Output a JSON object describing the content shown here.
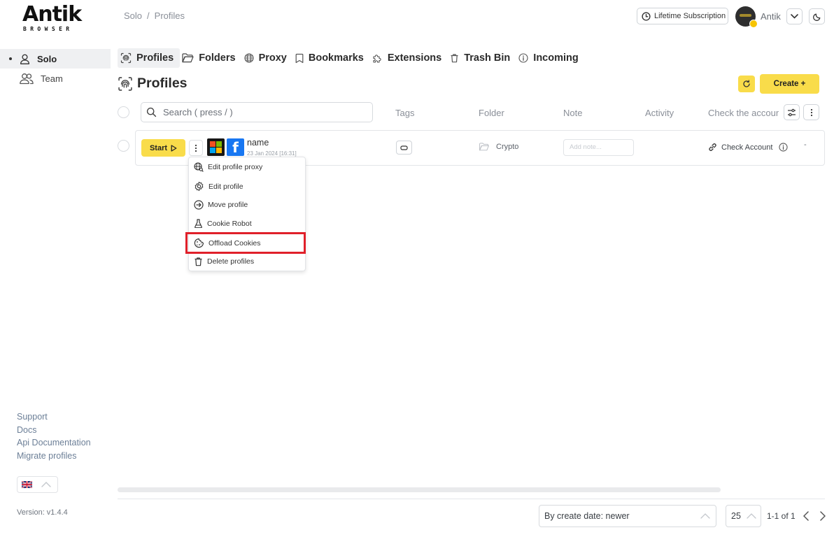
{
  "logo": {
    "word": "Antik",
    "sub": "BROWSER"
  },
  "breadcrumb": {
    "root": "Solo",
    "separator": "/",
    "current": "Profiles"
  },
  "header": {
    "subscription_label": "Lifetime Subscription",
    "username": "Antik"
  },
  "sidebar": {
    "items": [
      {
        "label": "Solo",
        "icon": "user-icon",
        "active": true
      },
      {
        "label": "Team",
        "icon": "users-icon",
        "active": false
      }
    ],
    "links": [
      "Support",
      "Docs",
      "Api Documentation",
      "Migrate profiles"
    ],
    "language": "en-gb",
    "version": "Version: v1.4.4"
  },
  "tabs": [
    {
      "label": "Profiles",
      "icon": "fingerprint-icon",
      "active": true
    },
    {
      "label": "Folders",
      "icon": "folder-icon"
    },
    {
      "label": "Proxy",
      "icon": "globe-icon"
    },
    {
      "label": "Bookmarks",
      "icon": "bookmark-icon"
    },
    {
      "label": "Extensions",
      "icon": "puzzle-icon"
    },
    {
      "label": "Trash Bin",
      "icon": "trash-icon"
    },
    {
      "label": "Incoming",
      "icon": "info-icon"
    }
  ],
  "page": {
    "title": "Profiles",
    "create_label": "Create +"
  },
  "table": {
    "search_placeholder": "Search ( press / )",
    "columns": {
      "tags": "Tags",
      "folder": "Folder",
      "note": "Note",
      "activity": "Activity",
      "check": "Check the account"
    },
    "rows": [
      {
        "start_label": "Start",
        "name": "name",
        "created": "23 Jan 2024 [16:31]",
        "folder": "Crypto",
        "note_placeholder": "Add note...",
        "check_label": "Check Account",
        "activity": "-"
      }
    ]
  },
  "menu": {
    "items": [
      {
        "label": "Edit profile proxy",
        "icon": "globe-search-icon"
      },
      {
        "label": "Edit profile",
        "icon": "gear-icon"
      },
      {
        "label": "Move profile",
        "icon": "arrow-circle-icon"
      },
      {
        "label": "Cookie Robot",
        "icon": "flask-icon"
      },
      {
        "label": "Offload Cookies",
        "icon": "cookie-icon",
        "highlighted": true
      },
      {
        "label": "Delete profiles",
        "icon": "trash-icon"
      }
    ],
    "highlight_color": "#e0202a"
  },
  "footer": {
    "sort_value": "By create date: newer",
    "per_page": "25",
    "page_info": "1-1 of 1"
  },
  "colors": {
    "accent": "#f9dc4a",
    "active_bg": "#eff0f2",
    "link": "#6c7f97"
  }
}
